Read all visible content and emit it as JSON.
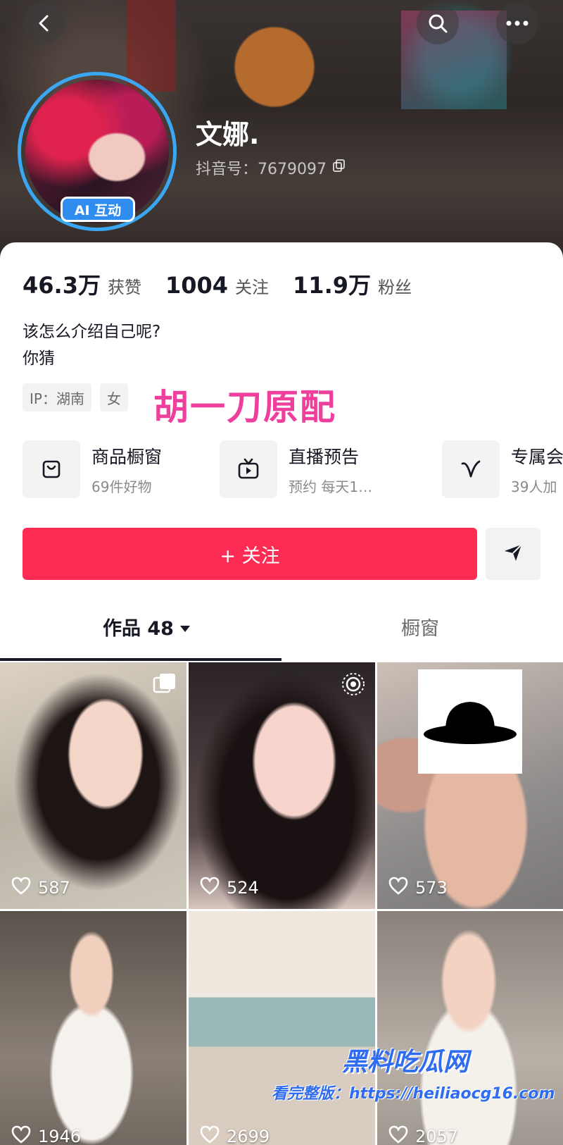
{
  "header": {
    "back_icon": "chevron-left-icon",
    "search_icon": "search-icon",
    "more_icon": "more-icon"
  },
  "profile": {
    "nickname": "文娜.",
    "douyin_id": "抖音号：7679097",
    "ai_badge": "AI 互动"
  },
  "stats": [
    {
      "value": "46.3万",
      "label": "获赞"
    },
    {
      "value": "1004",
      "label": "关注"
    },
    {
      "value": "11.9万",
      "label": "粉丝"
    }
  ],
  "bio": {
    "line1": "该怎么介绍自己呢?",
    "line2": "你猜"
  },
  "tags": [
    "IP：湖南",
    "女"
  ],
  "overlay_caption": "胡一刀原配",
  "features": [
    {
      "title": "商品橱窗",
      "subtitle": "69件好物",
      "icon": "shopping-bag-icon"
    },
    {
      "title": "直播预告",
      "subtitle": "预约 每天1…",
      "icon": "tv-icon"
    },
    {
      "title": "专属会",
      "subtitle": "39人加",
      "icon": "heart-check-icon"
    }
  ],
  "actions": {
    "follow_label": "+ 关注",
    "share_icon": "send-icon"
  },
  "tabs": [
    {
      "label": "作品 48",
      "active": true
    },
    {
      "label": "橱窗",
      "active": false
    }
  ],
  "videos": [
    {
      "likes": "587"
    },
    {
      "likes": "524"
    },
    {
      "likes": "573"
    },
    {
      "likes": "1946"
    },
    {
      "likes": "2699"
    },
    {
      "likes": "2057"
    }
  ],
  "watermark": {
    "title": "黑料吃瓜网",
    "subtitle": "看完整版：https://heiliaocg16.com"
  },
  "colors": {
    "accent": "#fe2c55",
    "badge": "#2f8df0",
    "caption": "#ee3f9c"
  }
}
